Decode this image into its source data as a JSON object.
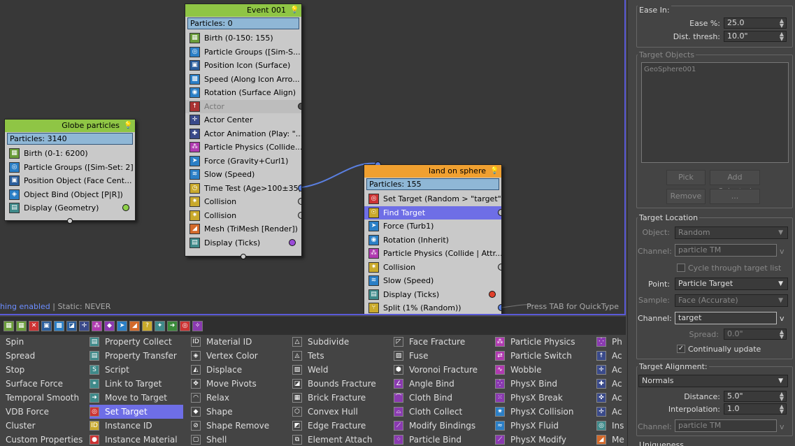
{
  "nodes": {
    "globe": {
      "title": "Globe particles",
      "count": "Particles: 3140",
      "ops": [
        "Birth (0-1: 6200)",
        "Particle Groups ([Sim-Set: 2] )",
        "Position Object (Face Cent...",
        "Object Bind (Object [P|R])",
        "Display (Geometry)"
      ]
    },
    "event": {
      "title": "Event  001",
      "count": "Particles: 0",
      "ops": [
        "Birth (0-150: 155)",
        "Particle Groups ([Sim-S...",
        "Position Icon (Surface)",
        "Speed (Along Icon Arro...",
        "Rotation (Surface Align)",
        "Actor",
        "Actor Center",
        "Actor Animation (Play: \"...",
        "Particle Physics (Collide...",
        "Force (Gravity+Curl1)",
        "Slow (Speed)",
        "Time Test (Age>100±35)",
        "Collision",
        "Collision",
        "Mesh (TriMesh [Render])",
        "Display (Ticks)"
      ]
    },
    "land": {
      "title": "land on sphere",
      "count": "Particles: 155",
      "ops": [
        "Set Target (Random > \"target\")",
        "Find Target",
        "Force (Turb1)",
        "Rotation (Inherit)",
        "Particle Physics (Collide | Attr...",
        "Collision",
        "Slow (Speed)",
        "Display (Ticks)",
        "Split (1% (Random))"
      ]
    }
  },
  "status": {
    "blue": "hing enabled",
    "rest": " | Static: NEVER"
  },
  "hint": "Press TAB for QuickType",
  "depot": {
    "col1": [
      "Spin",
      "Spread",
      "Stop",
      "Surface Force",
      "Temporal Smooth",
      "VDB Force",
      "Cluster",
      "Custom Properties"
    ],
    "col2": [
      "Property Collect",
      "Property Transfer",
      "Script",
      "Link to Target",
      "Move to Target",
      "Set Target",
      "Instance ID",
      "Instance Material"
    ],
    "col3": [
      "Material ID",
      "Vertex Color",
      "Displace",
      "Move Pivots",
      "Relax",
      "Shape",
      "Shape Remove",
      "Shell"
    ],
    "col4": [
      "Subdivide",
      "Tets",
      "Weld",
      "Bounds Fracture",
      "Brick Fracture",
      "Convex Hull",
      "Edge Fracture",
      "Element Attach"
    ],
    "col5": [
      "Face Fracture",
      "Fuse",
      "Voronoi Fracture",
      "Angle Bind",
      "Cloth Bind",
      "Cloth Collect",
      "Modify Bindings",
      "Particle Bind"
    ],
    "col6": [
      "Particle Physics",
      "Particle Switch",
      "Wobble",
      "PhysX Bind",
      "PhysX Break",
      "PhysX Collision",
      "PhysX Fluid",
      "PhysX Modify"
    ],
    "col7": [
      "Ph",
      "Ac",
      "Ac",
      "Ac",
      "Ac",
      "Ac",
      "Ins",
      "Me"
    ]
  },
  "panel": {
    "ease_in": "Ease In:",
    "ease_label": "Ease %:",
    "ease_value": "25.0",
    "dist_label": "Dist. thresh:",
    "dist_value": "10.0\"",
    "target_objects": "Target Objects",
    "target_obj_item": "GeoSphere001",
    "pick": "Pick",
    "add_selected": "Add Selected",
    "remove": "Remove",
    "ellipsis": "...",
    "target_location": "Target Location",
    "object_label": "Object:",
    "object_value": "Random",
    "channel_label": "Channel:",
    "channel_value": "particle TM",
    "v": "v",
    "cycle": "Cycle through target list",
    "point_label": "Point:",
    "point_value": "Particle Target",
    "sample_label": "Sample:",
    "sample_value": "Face (Accurate)",
    "channel2_label": "Channel:",
    "channel2_value": "target",
    "spread_label": "Spread:",
    "spread_value": "0.0\"",
    "continually": "Continually update",
    "target_alignment": "Target Alignment:",
    "align_value": "Normals",
    "distance_label": "Distance:",
    "distance_value": "5.0\"",
    "interp_label": "Interpolation:",
    "interp_value": "1.0",
    "channel3_label": "Channel:",
    "channel3_value": "particle TM",
    "uniqueness": "Uniqueness"
  }
}
